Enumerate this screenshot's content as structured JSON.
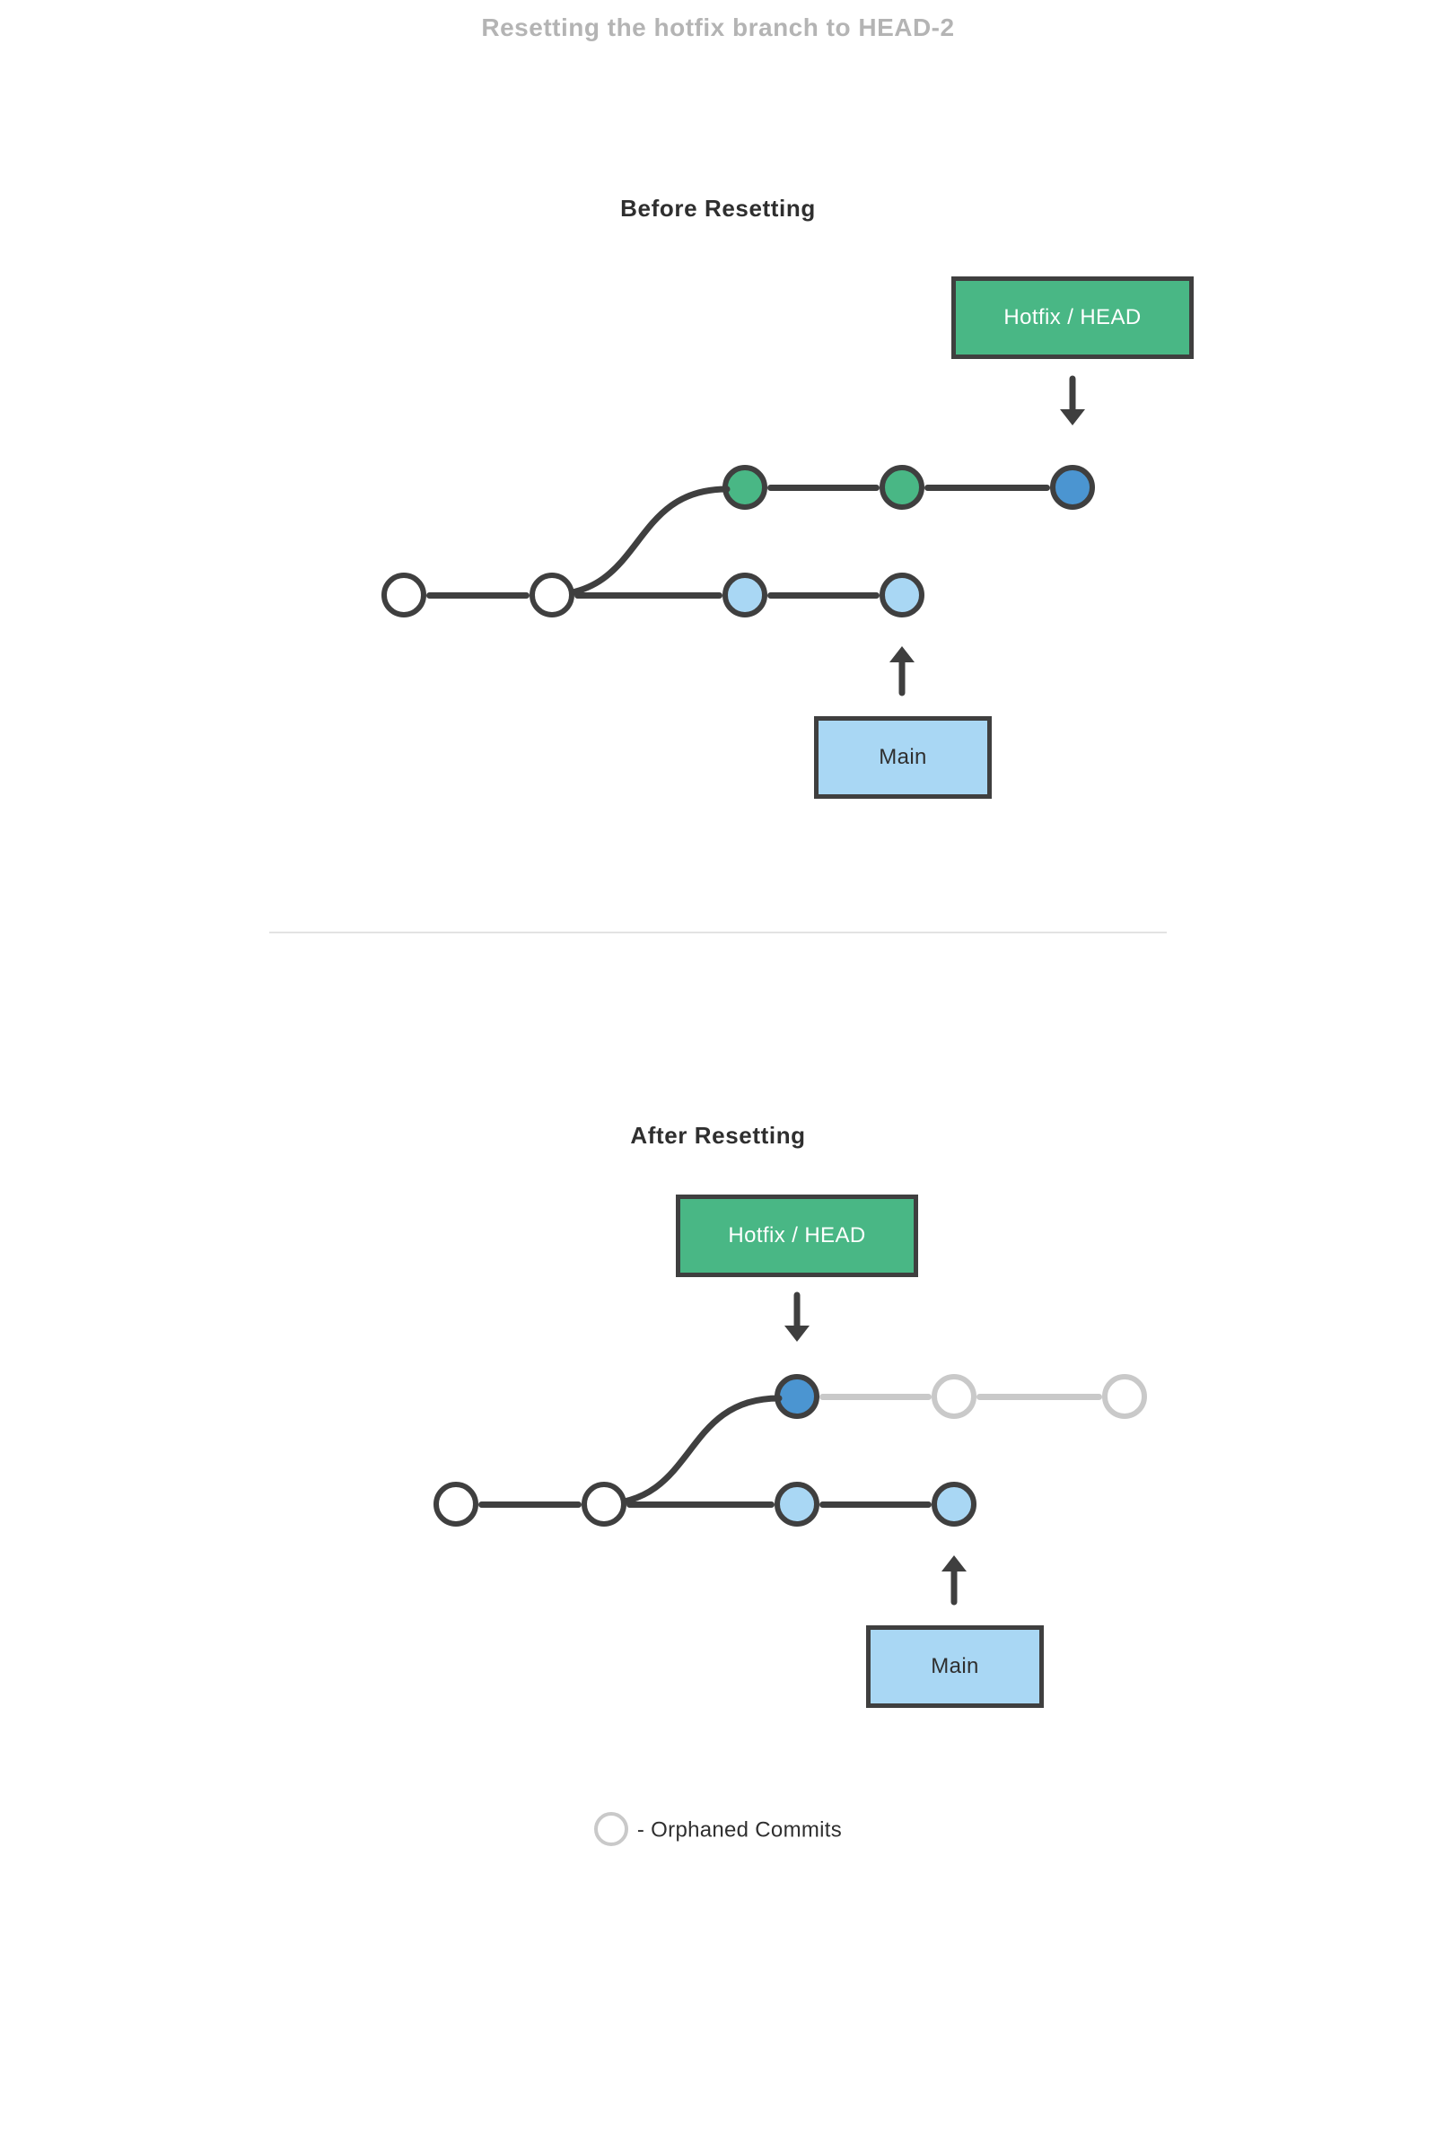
{
  "title": "Resetting the hotfix branch to HEAD-2",
  "colors": {
    "edge": "#3f3f3f",
    "orphan": "#c9c9c9",
    "green": "#49b785",
    "blue": "#4b95d1",
    "lightblue": "#a9d7f4",
    "white": "#ffffff",
    "divider": "#e3e3e3"
  },
  "before": {
    "heading": "Before Resetting",
    "tags": {
      "hotfix": "Hotfix / HEAD",
      "main": "Main"
    },
    "branches": {
      "main": {
        "position": "bottom",
        "commits": [
          "white",
          "white",
          "lightblue",
          "lightblue"
        ]
      },
      "hotfix": {
        "position": "top",
        "fork_after_main_index": 1,
        "commits": [
          "green",
          "green",
          "blue"
        ],
        "head_index": 2
      }
    }
  },
  "after": {
    "heading": "After Resetting",
    "tags": {
      "hotfix": "Hotfix / HEAD",
      "main": "Main"
    },
    "branches": {
      "main": {
        "position": "bottom",
        "commits": [
          "white",
          "white",
          "lightblue",
          "lightblue"
        ]
      },
      "hotfix": {
        "position": "top",
        "fork_after_main_index": 1,
        "commits": [
          "blue",
          "orphan",
          "orphan"
        ],
        "head_index": 0
      }
    },
    "orphaned_commit_indices": [
      1,
      2
    ]
  },
  "legend": {
    "label": "- Orphaned Commits"
  }
}
